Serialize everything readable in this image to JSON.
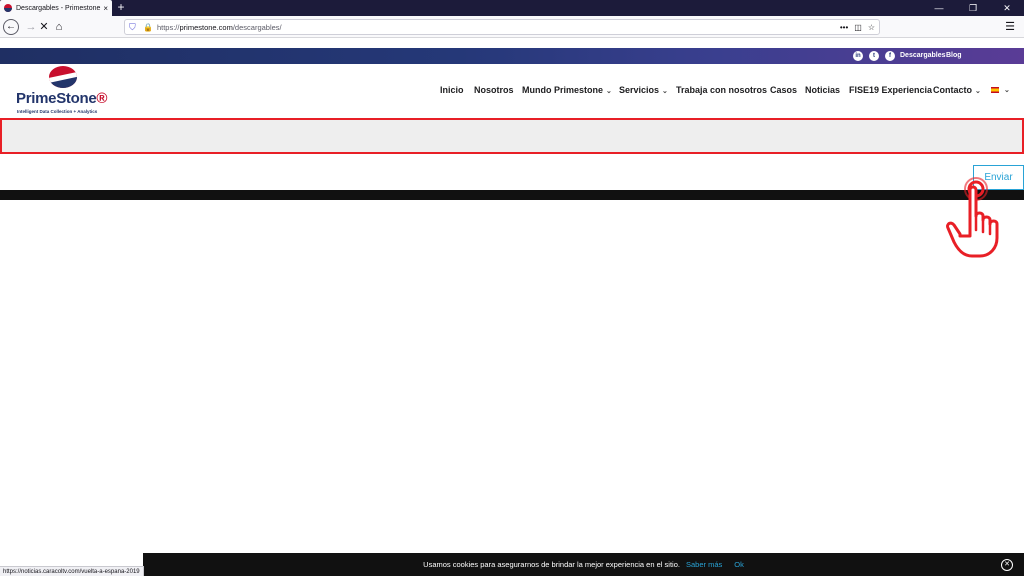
{
  "browser": {
    "tab_title": "Descargables - Primestone",
    "tab_close": "×",
    "new_tab": "+",
    "url_prefix": "https://",
    "url_host": "primestone.com",
    "url_path": "/descargables/",
    "window_controls": [
      "—",
      "❐",
      "✕"
    ]
  },
  "site": {
    "topbar_links": [
      "Descargables",
      "Blog"
    ],
    "social_icons": [
      "in",
      "t",
      "f"
    ],
    "logo": {
      "name_part1": "Prime",
      "name_part2": "Stone",
      "tagline": "Intelligent Data Collection + Analytics"
    },
    "nav": {
      "inicio": "Inicio",
      "nosotros": "Nosotros",
      "mundo": "Mundo Primestone",
      "servicios": "Servicios",
      "trabaja": "Trabaja con nosotros",
      "casos": "Casos",
      "noticias": "Noticias",
      "fise": "FISE19 Experiencia",
      "contacto": "Contacto"
    },
    "submit_label": "Enviar"
  },
  "footer": {
    "status_url": "https://noticias.caracoltv.com/vuelta-a-espana-2019",
    "cookie_message": "Usamos cookies para asegurarnos de brindar la mejor experiencia en el sitio.",
    "cookie_more": "Saber más",
    "cookie_ok": "Ok"
  },
  "colors": {
    "highlight_border": "#e81f26",
    "brand_navy": "#23356b",
    "brand_red": "#c8102e",
    "link_blue": "#29a3d6"
  }
}
